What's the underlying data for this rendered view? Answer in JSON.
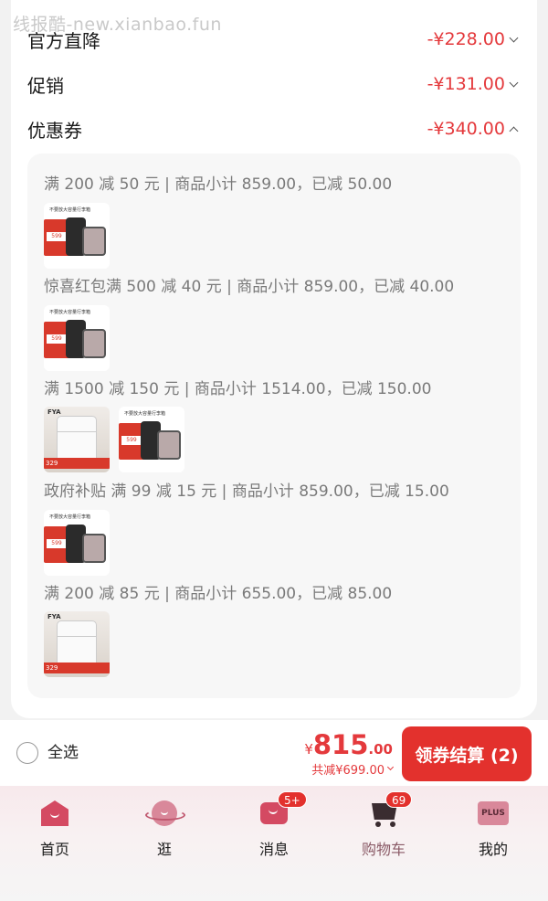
{
  "watermark": "线报酷-new.xianbao.fun",
  "discounts": [
    {
      "label": "官方直降",
      "amount": "-¥228.00",
      "expanded": false
    },
    {
      "label": "促销",
      "amount": "-¥131.00",
      "expanded": false
    },
    {
      "label": "优惠券",
      "amount": "-¥340.00",
      "expanded": true
    }
  ],
  "coupons": [
    {
      "text": "满 200 减 50 元 | 商品小计 859.00，已减 50.00",
      "thumbs": [
        "luggage"
      ]
    },
    {
      "text": "惊喜红包满 500 减 40 元 | 商品小计 859.00，已减 40.00",
      "thumbs": [
        "luggage"
      ]
    },
    {
      "text": "满 1500 减 150 元 | 商品小计 1514.00，已减 150.00",
      "thumbs": [
        "fridge",
        "luggage"
      ]
    },
    {
      "text": "政府补贴 满 99 减 15 元 | 商品小计 859.00，已减 15.00",
      "thumbs": [
        "luggage"
      ]
    },
    {
      "text": "满 200 减 85 元 | 商品小计 655.00，已减 85.00",
      "thumbs": [
        "fridge"
      ]
    }
  ],
  "thumb_text": {
    "luggage_header": "不要放大容量行李箱",
    "luggage_price": "599",
    "fridge_brand": "FYA",
    "fridge_price": "329"
  },
  "bottom_bar": {
    "select_all": "全选",
    "currency": "¥",
    "total_int": "815",
    "total_dec": ".00",
    "saved": "共减¥699.00",
    "checkout": "领券结算 (2)"
  },
  "tabs": [
    {
      "label": "首页",
      "icon": "home-icon",
      "badge": ""
    },
    {
      "label": "逛",
      "icon": "planet-icon",
      "badge": ""
    },
    {
      "label": "消息",
      "icon": "message-icon",
      "badge": "5+"
    },
    {
      "label": "购物车",
      "icon": "cart-icon",
      "badge": "69",
      "active": true
    },
    {
      "label": "我的",
      "icon": "plus-icon",
      "badge": "",
      "icon_text": "PLUS"
    }
  ],
  "colors": {
    "accent": "#e3312d",
    "price": "#e4393c",
    "tab_active": "#8a5a66"
  }
}
